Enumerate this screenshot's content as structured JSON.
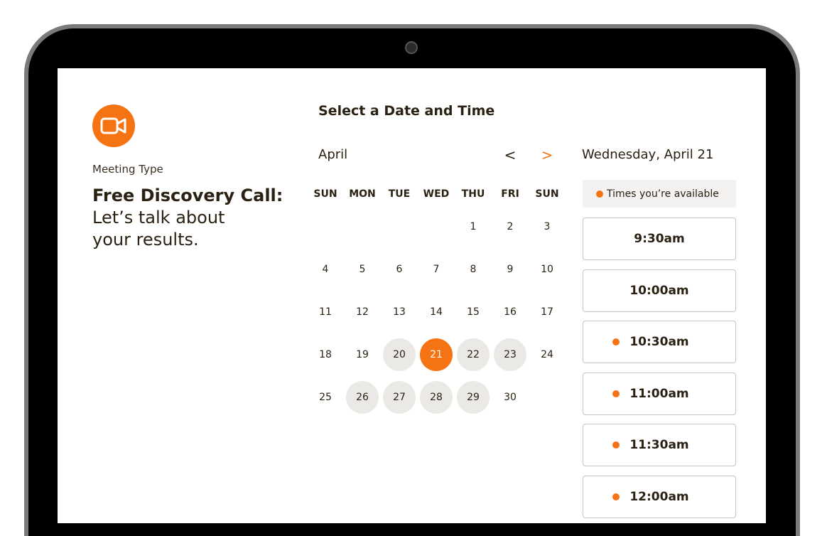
{
  "event": {
    "meeting_type_label": "Meeting Type",
    "title": "Free Discovery Call:",
    "subtitle_line1": "Let’s talk about",
    "subtitle_line2": "your results.",
    "icon": "video-camera-icon"
  },
  "scheduler": {
    "heading": "Select a Date and Time",
    "month": "April",
    "prev_label": "<",
    "next_label": ">",
    "weekdays": [
      "SUN",
      "MON",
      "TUE",
      "WED",
      "THU",
      "FRI",
      "SUN"
    ],
    "weeks": [
      [
        null,
        null,
        null,
        null,
        {
          "d": "1"
        },
        {
          "d": "2"
        },
        {
          "d": "3"
        }
      ],
      [
        {
          "d": "4"
        },
        {
          "d": "5"
        },
        {
          "d": "6"
        },
        {
          "d": "7"
        },
        {
          "d": "8"
        },
        {
          "d": "9"
        },
        {
          "d": "10"
        }
      ],
      [
        {
          "d": "11"
        },
        {
          "d": "12"
        },
        {
          "d": "13"
        },
        {
          "d": "14"
        },
        {
          "d": "15"
        },
        {
          "d": "16"
        },
        {
          "d": "17"
        }
      ],
      [
        {
          "d": "18"
        },
        {
          "d": "19"
        },
        {
          "d": "20",
          "s": "avail"
        },
        {
          "d": "21",
          "s": "selected"
        },
        {
          "d": "22",
          "s": "avail"
        },
        {
          "d": "23",
          "s": "avail"
        },
        {
          "d": "24"
        }
      ],
      [
        {
          "d": "25"
        },
        {
          "d": "26",
          "s": "avail"
        },
        {
          "d": "27",
          "s": "avail"
        },
        {
          "d": "28",
          "s": "avail"
        },
        {
          "d": "29",
          "s": "avail"
        },
        {
          "d": "30"
        },
        null
      ]
    ]
  },
  "times": {
    "selected_date": "Wednesday, April 21",
    "legend": "Times you’re available",
    "slots": [
      {
        "label": "9:30am",
        "dot": false
      },
      {
        "label": "10:00am",
        "dot": false
      },
      {
        "label": "10:30am",
        "dot": true
      },
      {
        "label": "11:00am",
        "dot": true
      },
      {
        "label": "11:30am",
        "dot": true
      },
      {
        "label": "12:00am",
        "dot": true
      }
    ]
  },
  "colors": {
    "accent": "#f57313",
    "available_day_bg": "#ebe9e6",
    "text": "#2b2113"
  }
}
